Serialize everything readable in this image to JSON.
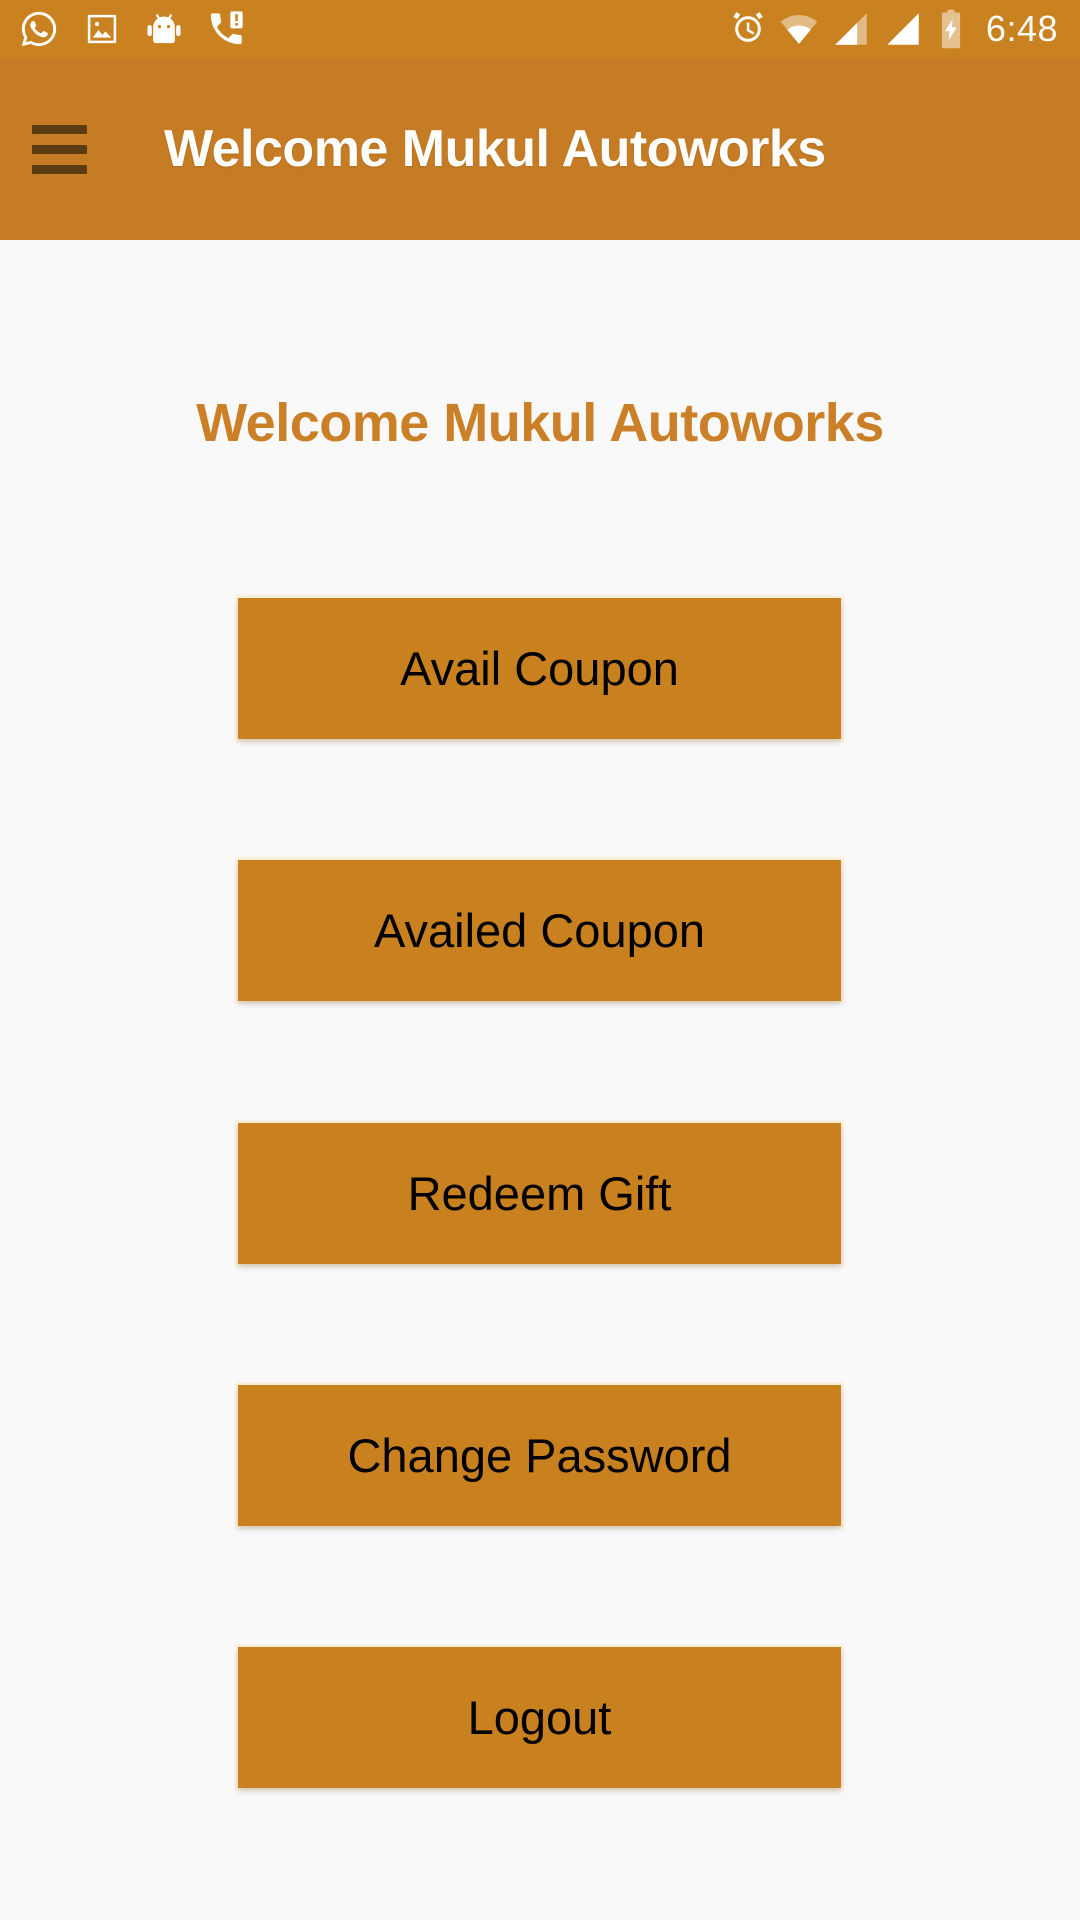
{
  "status_bar": {
    "time": "6:48",
    "left_icons": [
      {
        "name": "whatsapp-icon"
      },
      {
        "name": "image-gallery-icon"
      },
      {
        "name": "android-system-icon"
      },
      {
        "name": "missed-call-icon"
      }
    ],
    "right_icons": [
      {
        "name": "alarm-clock-icon"
      },
      {
        "name": "wifi-icon"
      },
      {
        "name": "signal-sim1-icon"
      },
      {
        "name": "signal-sim2-icon"
      },
      {
        "name": "battery-charging-icon"
      }
    ]
  },
  "app_bar": {
    "menu_icon": "hamburger-menu-icon",
    "title": "Welcome Mukul Autoworks"
  },
  "main": {
    "heading": "Welcome Mukul Autoworks",
    "buttons": [
      {
        "label": "Avail Coupon",
        "name": "avail-coupon-button"
      },
      {
        "label": "Availed Coupon",
        "name": "availed-coupon-button"
      },
      {
        "label": "Redeem Gift",
        "name": "redeem-gift-button"
      },
      {
        "label": "Change Password",
        "name": "change-password-button"
      },
      {
        "label": "Logout",
        "name": "logout-button"
      }
    ]
  },
  "colors": {
    "status_bar_bg": "#c9821f",
    "app_bar_bg": "#c67c24",
    "button_bg": "#c9801f",
    "heading_text": "#cb7f26",
    "page_bg": "#f9f9f9",
    "menu_icon": "#5a3b12",
    "button_text": "#000000",
    "app_bar_title_text": "#ffffff"
  }
}
